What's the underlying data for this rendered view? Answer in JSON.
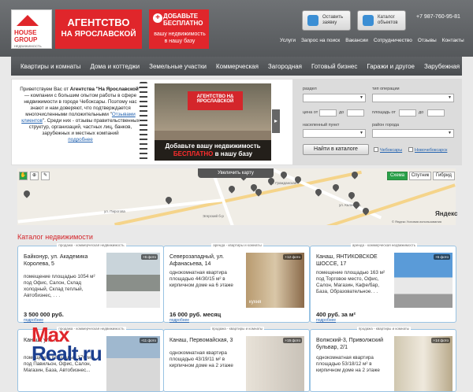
{
  "header": {
    "logo": {
      "line1": "HOUSE",
      "line2": "GROUP",
      "line3": "НЕДВИЖИМОСТЬ"
    },
    "agency": {
      "line1": "АГЕНТСТВО",
      "line2": "НА ЯРОСЛАВСКОЙ"
    },
    "add_free": {
      "plus": "+",
      "line1": "ДОБАВЬТЕ",
      "line2": "БЕСПЛАТНО",
      "line3": "вашу недвижимость в нашу базу"
    },
    "btn_application": "Оставить заявку",
    "btn_catalog": "Каталог объектов",
    "phone": "+7 987-760-95-81",
    "top_nav": [
      "Услуги",
      "Запрос на поиск",
      "Вакансии",
      "Сотрудничество",
      "Отзывы",
      "Контакты"
    ]
  },
  "main_menu": [
    "Квартиры и комнаты",
    "Дома и коттеджи",
    "Земельные участки",
    "Коммерческая",
    "Загородная",
    "Готовый бизнес",
    "Гаражи и другое",
    "Зарубежная"
  ],
  "welcome": {
    "text_before": "Приветствуем Вас от",
    "agency_name": "Агентства \"На Ярославской\"",
    "text_mid": " — компании с большим опытом работы в сфере недвижимости в городе Чебоксары. Поэтому нас знают и нам доверяют, что подтверждается многочисленными положительными \"",
    "reviews_link": "Отзывами клиентов",
    "text_after": "\". Среди них - отзывы правительственных структур, организаций, частных лиц, банков, зарубежных и местных компаний",
    "more": "подробнее",
    "photo_sign": "АГЕНТСТВО НА ЯРОСЛАВСКОЙ",
    "photo_banner1": "Добавьте вашу недвижимость",
    "photo_banner2": "БЕСПЛАТНО",
    "photo_banner3": " в нашу базу"
  },
  "search": {
    "region_label": "раздел",
    "type_label": "тип операции",
    "price_label": "цена от",
    "price_to": "до",
    "area_label": "площадь от",
    "area_to": "до",
    "city_label": "населенный пункт",
    "district_label": "район города",
    "find_button": "Найти в каталоге",
    "cb1": "Чебоксары",
    "cb2": "Новочебоксарск"
  },
  "map": {
    "zoom_label": "Увеличить карту",
    "btn_scheme": "Схема",
    "btn_satellite": "Спутник",
    "btn_hybrid": "Гибрид",
    "logo": "Яндекс",
    "copyright": "© Яндекс Условия использования",
    "streets": [
      "ул. Пирогова",
      "ул. Калинина",
      "ул. Гражданская",
      "Эгерский б-р"
    ]
  },
  "catalog": {
    "title": "Каталог недвижимости",
    "cards": [
      {
        "tag": "продажа - коммерческая недвижимость",
        "address": "Байконур, ул. Академика Королева, 5",
        "description": "помещение площадью 1054 м² под Офис, Салон, Склад холодный, Склад теплый, Автобизнес, . . .",
        "price": "3 500 000 руб.",
        "more": "подробнее",
        "photos": "+6 фото"
      },
      {
        "tag": "аренда - квартиры и комнаты",
        "address": "Северозападный, ул. Афанасьева, 14",
        "description": "однокомнатная квартира площадью 44/30/15 м² в кирпичном доме на 6 этаже",
        "price": "16 000 руб. месяц",
        "more": "подробнее",
        "photos": "+12 фото",
        "img_caption": "кухня"
      },
      {
        "tag": "аренда - коммерческая недвижимость",
        "address": "Канаш, ЯНТИКОВСКОЕ ШОССЕ, 17",
        "description": "помещение площадью 163 м² под Торговое место, Офис, Салон, Магазин, Кафе/бар, База, Образовательное. . .",
        "price": "400 руб. за м²",
        "more": "подробнее",
        "photos": "+6 фото"
      },
      {
        "tag": "продажа - коммерческая недвижимость",
        "address": "Канаш, ул. ...",
        "description": "помещение площадью 176 м² под Павильон, Офис, Салон, Магазин, База, Автобизнес...",
        "price": "",
        "more": "",
        "photos": "+11 фото"
      },
      {
        "tag": "продажа - квартиры и комнаты",
        "address": "Канаш, Первомайская, 3",
        "description": "однокомнатная квартира площадью 43/19/11 м² в кирпичном доме на 2 этаже",
        "price": "",
        "more": "",
        "photos": "+15 фото"
      },
      {
        "tag": "продажа - квартиры и комнаты",
        "address": "Волжский-3, Приволжский бульвар, 2/1",
        "description": "однокомнатная квартира площадью 53/18/12 м² в кирпичном доме на 2 этаже",
        "price": "",
        "more": "",
        "photos": "+14 фото"
      }
    ]
  },
  "watermark": {
    "line1": "Max",
    "line2": "Realt.ru"
  }
}
